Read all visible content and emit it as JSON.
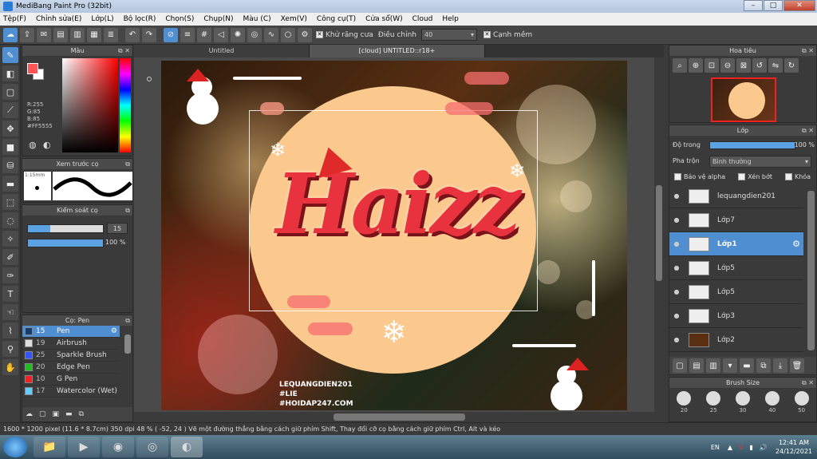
{
  "window": {
    "title": "MediBang Paint Pro (32bit)"
  },
  "menu": [
    "Tệp(F)",
    "Chỉnh sửa(E)",
    "Lớp(L)",
    "Bộ lọc(R)",
    "Chọn(S)",
    "Chụp(N)",
    "Màu (C)",
    "Xem(V)",
    "Công cụ(T)",
    "Cửa sổ(W)",
    "Cloud",
    "Help"
  ],
  "toolbar": {
    "antialias_label": "Khử răng cưa",
    "adjust_label": "Điều chỉnh",
    "adjust_value": "40",
    "edge_label": "Cạnh mềm"
  },
  "color_panel": {
    "title": "Màu",
    "r": "R:255",
    "g": "G:85",
    "b": "B:85",
    "hex": "#FF5555"
  },
  "preview_panel": {
    "title": "Xem trước cọ",
    "size": "1:15mm"
  },
  "brush_control": {
    "title": "Kiểm soát cọ",
    "size": "15",
    "opacity": "100 %"
  },
  "brush_panel": {
    "title": "Cọ: Pen",
    "items": [
      {
        "size": "15",
        "name": "Pen",
        "color": "#1a3b6e"
      },
      {
        "size": "19",
        "name": "Airbrush",
        "color": "#dddddd"
      },
      {
        "size": "25",
        "name": "Sparkle Brush",
        "color": "#3355ff"
      },
      {
        "size": "20",
        "name": "Edge Pen",
        "color": "#22bb22"
      },
      {
        "size": "10",
        "name": "G Pen",
        "color": "#ee2222"
      },
      {
        "size": "17",
        "name": "Watercolor (Wet)",
        "color": "#66ccff"
      }
    ]
  },
  "tabs": [
    {
      "label": "Untitled"
    },
    {
      "label": "[cloud] UNTITLED::r18+"
    }
  ],
  "artwork": {
    "title_text": "Haizz",
    "signature": [
      "LEQUANGDIEN201",
      "#LIE",
      "#HOIDAP247.COM"
    ]
  },
  "navigator": {
    "title": "Hoa tiêu"
  },
  "layer_panel": {
    "title": "Lớp",
    "opacity_label": "Độ trong",
    "opacity_value": "100 %",
    "blend_label": "Pha trộn",
    "blend_value": "Bình thường",
    "protect_alpha": "Bảo vệ alpha",
    "clipping": "Xén bớt",
    "lock": "Khóa",
    "layers": [
      {
        "name": "lequangdien201",
        "selected": false
      },
      {
        "name": "Lớp7",
        "selected": false
      },
      {
        "name": "Lớp1",
        "selected": true
      },
      {
        "name": "Lớp5",
        "selected": false
      },
      {
        "name": "Lớp5",
        "selected": false
      },
      {
        "name": "Lớp3",
        "selected": false
      },
      {
        "name": "Lớp2",
        "selected": false
      }
    ]
  },
  "brush_size_panel": {
    "title": "Brush Size",
    "sizes": [
      "20",
      "25",
      "30",
      "40",
      "50"
    ]
  },
  "status": {
    "text": "1600 * 1200 pixel   (11.6 * 8.7cm)   350 dpi   48 %   ( -52, 24 )   Vẽ một đường thẳng bằng cách giữ phím Shift, Thay đổi cỡ cọ bằng cách giữ phím Ctrl, Alt và kéo"
  },
  "taskbar": {
    "lang": "EN",
    "time": "12:41 AM",
    "date": "24/12/2021"
  },
  "colors": {
    "accent": "#4f8ed0",
    "panel": "#3a3a3a",
    "fg_color": "#ff5555"
  }
}
